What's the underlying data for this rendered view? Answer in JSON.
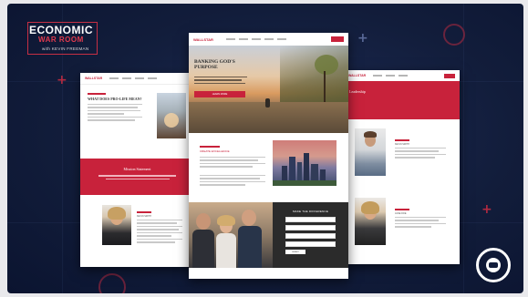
{
  "logo": {
    "line1": "ECONOMIC",
    "line2": "WAR ROOM",
    "line3": "with KEVIN FREEMAN"
  },
  "left_page": {
    "brand": "WALLSTAR",
    "heading": "WHAT DOES PRO-LIFE MEAN?",
    "band_title": "Mission Statement",
    "bio_title": "KEVIN SMITH"
  },
  "center_page": {
    "brand": "WALLSTAR",
    "hero_title": "BANKING GOD'S PURPOSE",
    "hero_button": "LEARN MORE",
    "section_title": "CREATE EXCELLENCE",
    "form_title": "MAKE THE DIFFERENCE",
    "form_button": "SUBMIT"
  },
  "right_page": {
    "brand": "WALLSTAR",
    "band_title": "Leadership",
    "person1": "KEVIN SMITH",
    "person2": "JANE DOE"
  },
  "colors": {
    "accent": "#c8223b",
    "background": "#121d3b"
  },
  "icons": [
    "plus-icon",
    "rumble-logo-icon"
  ]
}
